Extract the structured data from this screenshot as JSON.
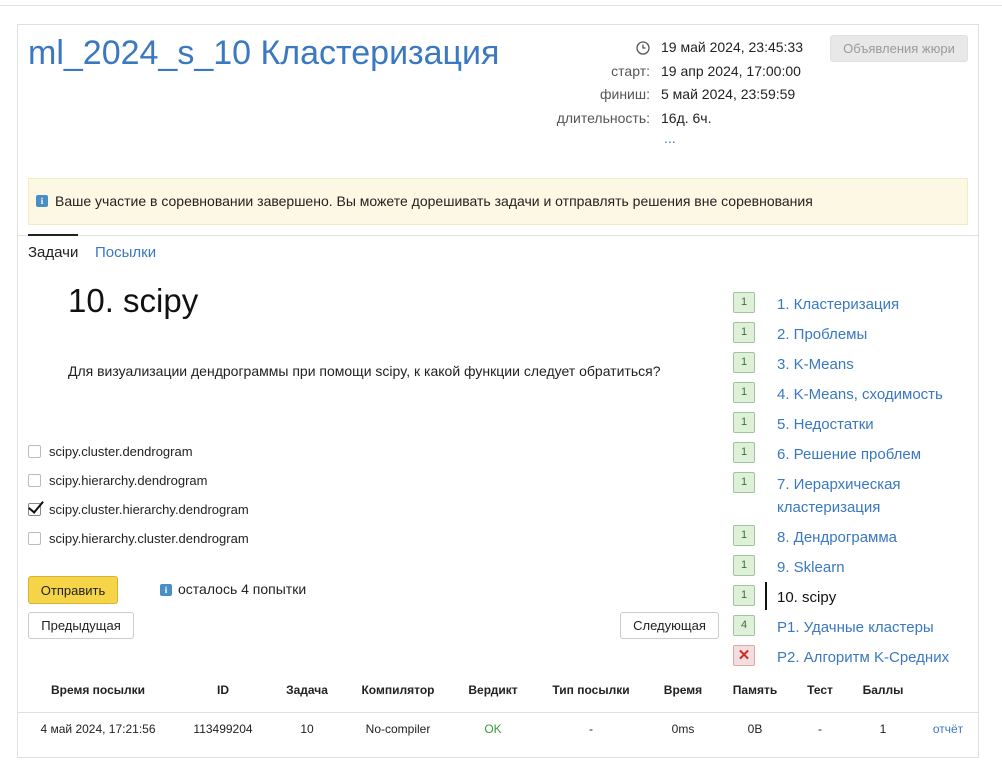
{
  "contest": {
    "title": "ml_2024_s_10 Кластеризация",
    "current_time": "19 май 2024, 23:45:33",
    "start_label": "старт:",
    "start_value": "19 апр 2024, 17:00:00",
    "finish_label": "финиш:",
    "finish_value": "5 май 2024, 23:59:59",
    "duration_label": "длительность:",
    "duration_value": "16д. 6ч.",
    "more": "...",
    "jury_button": "Объявления жюри"
  },
  "alert": {
    "text": "Ваше участие в соревновании завершено. Вы можете дорешивать задачи и отправлять решения вне соревнования"
  },
  "tabs": [
    {
      "label": "Задачи",
      "active": true
    },
    {
      "label": "Посылки",
      "active": false
    }
  ],
  "problem": {
    "title": "10. scipy",
    "question": "Для визуализации дендрограммы при помощи scipy, к какой функции следует обратиться?",
    "options": [
      {
        "label": "scipy.cluster.dendrogram",
        "checked": false
      },
      {
        "label": "scipy.hierarchy.dendrogram",
        "checked": false
      },
      {
        "label": "scipy.cluster.hierarchy.dendrogram",
        "checked": true
      },
      {
        "label": "scipy.hierarchy.cluster.dendrogram",
        "checked": false
      }
    ],
    "submit_label": "Отправить",
    "attempts_text": "осталось 4 попытки",
    "prev_label": "Предыдущая",
    "next_label": "Следующая"
  },
  "problems": [
    {
      "badge": "1",
      "label": "1. Кластеризация",
      "status": "ok"
    },
    {
      "badge": "1",
      "label": "2. Проблемы",
      "status": "ok"
    },
    {
      "badge": "1",
      "label": "3. K-Means",
      "status": "ok"
    },
    {
      "badge": "1",
      "label": "4. K-Means, сходимость",
      "status": "ok"
    },
    {
      "badge": "1",
      "label": "5. Недостатки",
      "status": "ok"
    },
    {
      "badge": "1",
      "label": "6. Решение проблем",
      "status": "ok"
    },
    {
      "badge": "1",
      "label": "7. Иерархическая кластеризация",
      "status": "ok"
    },
    {
      "badge": "1",
      "label": "8. Дендрограмма",
      "status": "ok"
    },
    {
      "badge": "1",
      "label": "9. Sklearn",
      "status": "ok"
    },
    {
      "badge": "1",
      "label": "10. scipy",
      "status": "ok",
      "current": true
    },
    {
      "badge": "4",
      "label": "P1. Удачные кластеры",
      "status": "ok"
    },
    {
      "badge": "✕",
      "label": "P2. Алгоритм K-Средних",
      "status": "fail"
    }
  ],
  "submissions": {
    "headers": [
      "Время посылки",
      "ID",
      "Задача",
      "Компилятор",
      "Вердикт",
      "Тип посылки",
      "Время",
      "Память",
      "Тест",
      "Баллы"
    ],
    "rows": [
      {
        "time": "4 май 2024, 17:21:56",
        "id": "113499204",
        "task": "10",
        "compiler": "No-compiler",
        "verdict": "OK",
        "type": "-",
        "run_time": "0ms",
        "memory": "0B",
        "test": "-",
        "score": "1",
        "report": "отчёт"
      }
    ]
  },
  "colors": {
    "link": "#3a78c0",
    "accent_button": "#f5d547",
    "ok_badge": "#dff0d8",
    "fail_badge": "#f2dede",
    "alert_bg": "#fcf8e3"
  },
  "icons": {
    "clock": "clock-icon",
    "info": "info-icon",
    "fail": "cross-icon"
  }
}
